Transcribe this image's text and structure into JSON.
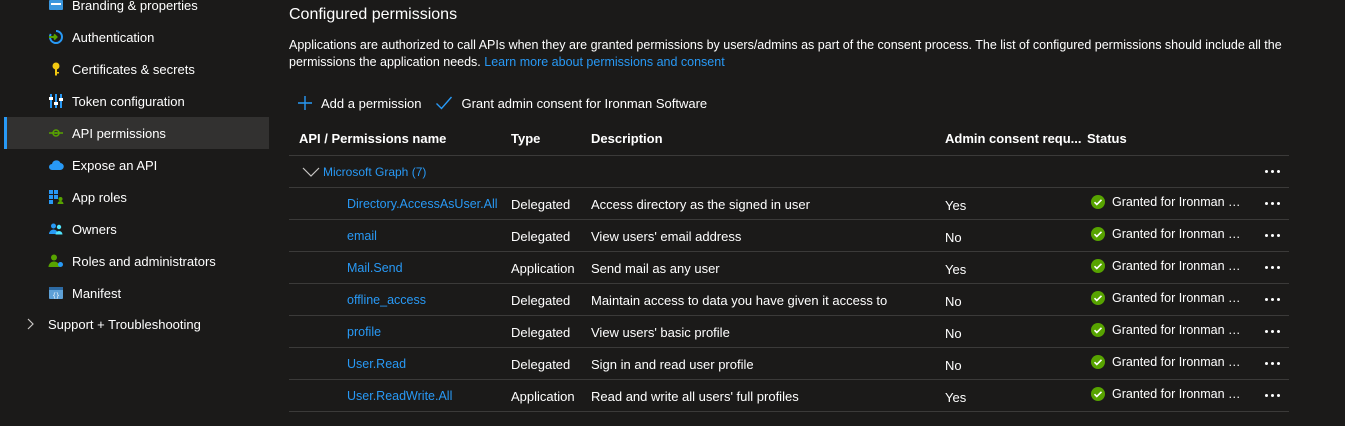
{
  "sidebar": {
    "items": [
      {
        "label": "Branding & properties",
        "icon": "branding-icon"
      },
      {
        "label": "Authentication",
        "icon": "authentication-icon"
      },
      {
        "label": "Certificates & secrets",
        "icon": "key-icon"
      },
      {
        "label": "Token configuration",
        "icon": "token-config-icon"
      },
      {
        "label": "API permissions",
        "icon": "api-permissions-icon",
        "active": true
      },
      {
        "label": "Expose an API",
        "icon": "cloud-icon"
      },
      {
        "label": "App roles",
        "icon": "app-roles-icon"
      },
      {
        "label": "Owners",
        "icon": "owners-icon"
      },
      {
        "label": "Roles and administrators",
        "icon": "roles-admin-icon"
      },
      {
        "label": "Manifest",
        "icon": "manifest-icon"
      }
    ],
    "group": {
      "label": "Support + Troubleshooting",
      "icon": "chevron-right-icon"
    }
  },
  "main": {
    "title": "Configured permissions",
    "description": "Applications are authorized to call APIs when they are granted permissions by users/admins as part of the consent process. The list of configured permissions should include all the permissions the application needs.",
    "learn_more": "Learn more about permissions and consent",
    "toolbar": {
      "add_label": "Add a permission",
      "grant_label": "Grant admin consent for Ironman Software"
    },
    "table": {
      "headers": {
        "name": "API / Permissions name",
        "type": "Type",
        "description": "Description",
        "admin": "Admin consent requ...",
        "status": "Status"
      },
      "group": "Microsoft Graph (7)",
      "rows": [
        {
          "name": "Directory.AccessAsUser.All",
          "type": "Delegated",
          "description": "Access directory as the signed in user",
          "admin": "Yes",
          "status": "Granted for Ironman So..."
        },
        {
          "name": "email",
          "type": "Delegated",
          "description": "View users' email address",
          "admin": "No",
          "status": "Granted for Ironman So..."
        },
        {
          "name": "Mail.Send",
          "type": "Application",
          "description": "Send mail as any user",
          "admin": "Yes",
          "status": "Granted for Ironman So..."
        },
        {
          "name": "offline_access",
          "type": "Delegated",
          "description": "Maintain access to data you have given it access to",
          "admin": "No",
          "status": "Granted for Ironman So..."
        },
        {
          "name": "profile",
          "type": "Delegated",
          "description": "View users' basic profile",
          "admin": "No",
          "status": "Granted for Ironman So..."
        },
        {
          "name": "User.Read",
          "type": "Delegated",
          "description": "Sign in and read user profile",
          "admin": "No",
          "status": "Granted for Ironman So..."
        },
        {
          "name": "User.ReadWrite.All",
          "type": "Application",
          "description": "Read and write all users' full profiles",
          "admin": "Yes",
          "status": "Granted for Ironman So..."
        }
      ]
    }
  },
  "colors": {
    "accent": "#2899f5",
    "success": "#57a300",
    "background": "#1b1a19",
    "selected": "#323130"
  }
}
